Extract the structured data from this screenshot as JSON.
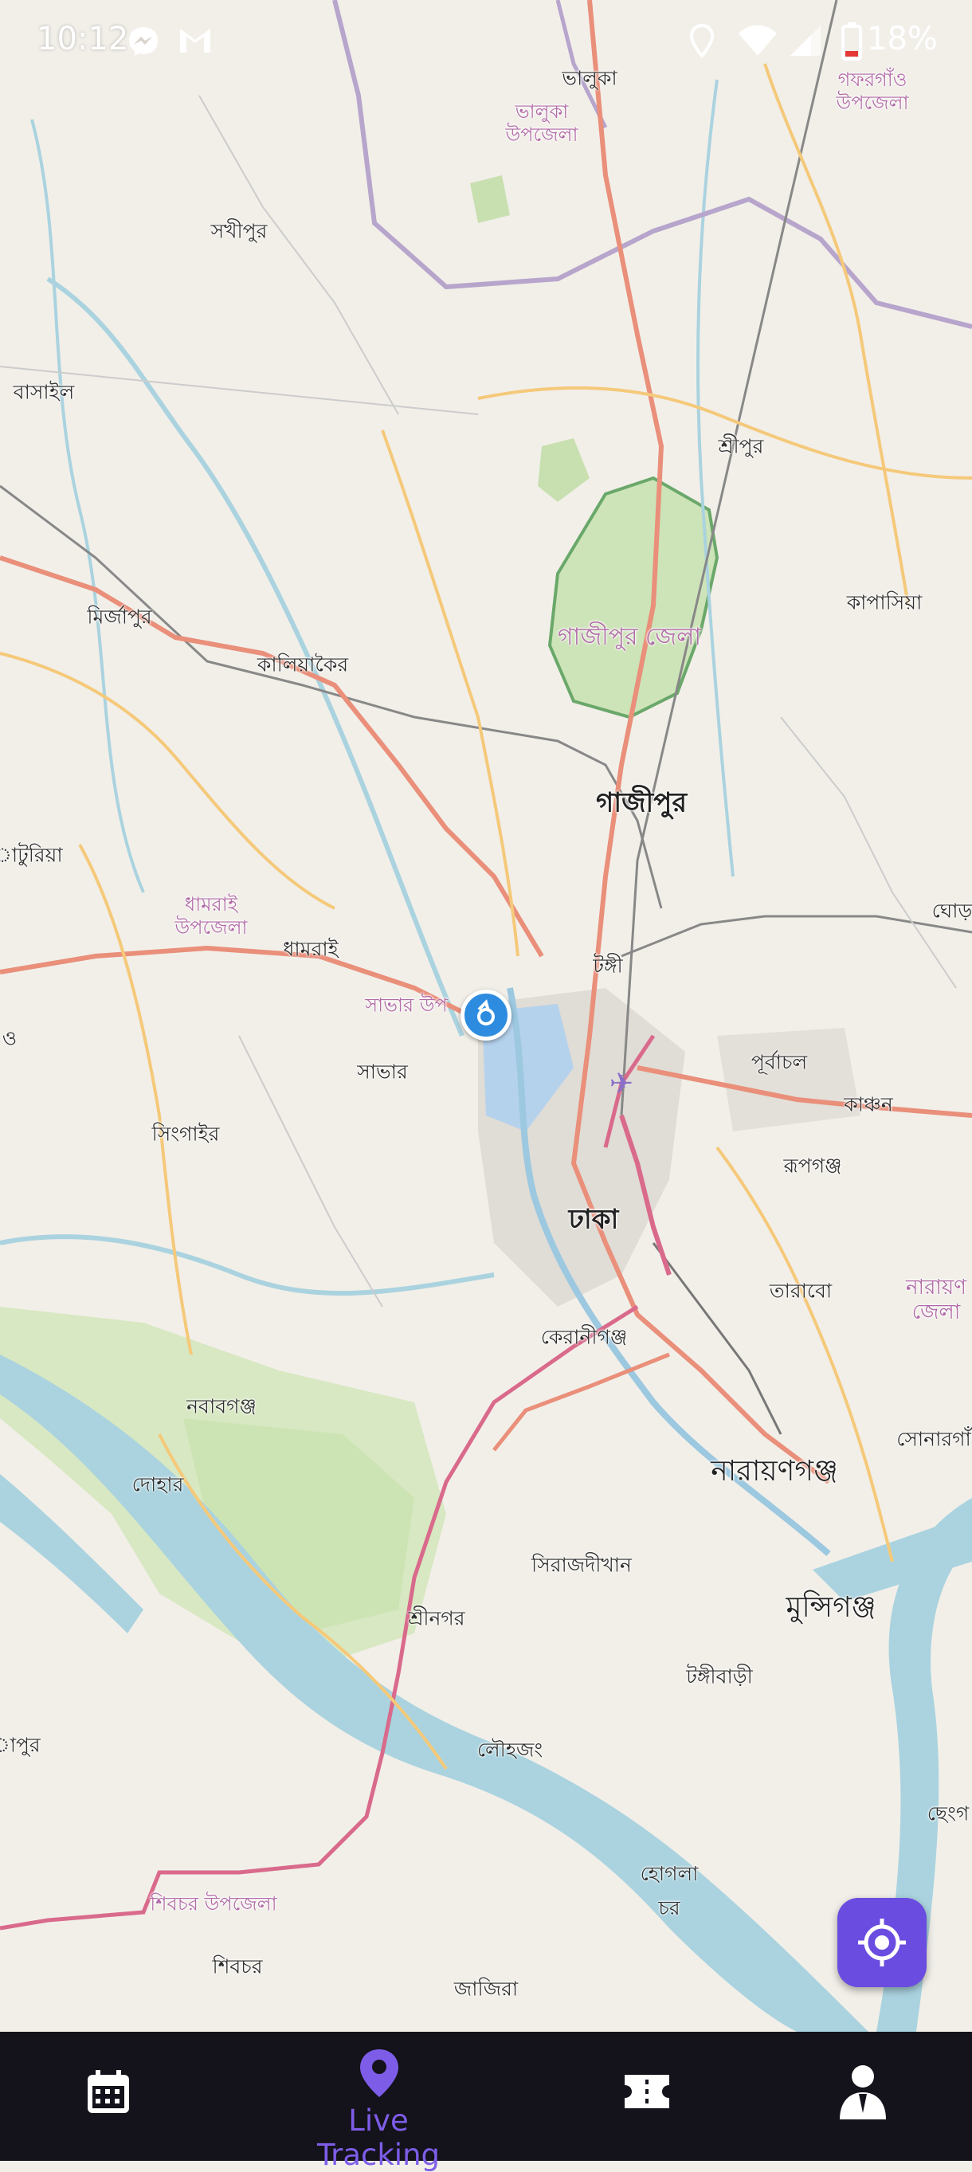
{
  "status_bar": {
    "time": "10:12",
    "battery": "18%",
    "icons": [
      "messenger-icon",
      "gmail-icon",
      "location-icon",
      "wifi-icon",
      "signal-icon",
      "battery-icon"
    ]
  },
  "map": {
    "places": {
      "bhaluka": "ভালুকা",
      "bhaluka_upazila": "ভালুকা উপজেলা",
      "gafargaon_upazila": "গফরগাঁও উপজেলা",
      "sakhipur": "সখীপুর",
      "basail": "বাসাইল",
      "sreepur": "শ্রীপুর",
      "mirzapur": "মির্জাপুর",
      "gazipur_zila": "গাজীপুর জেলা",
      "kapasia": "কাপাসিয়া",
      "kaliakair": "কালিয়াকৈর",
      "gazipur": "গাজীপুর",
      "saturia": "াটুরিয়া",
      "dhamrai_upazila": "ধামরাই উপজেলা",
      "dhamrai": "ধামরাই",
      "ghora": "ঘোড়",
      "tongi": "টঙ্গী",
      "savar_upazila": "সাভার উপ",
      "savar": "সাভার",
      "purbachal": "পূর্বাচল",
      "kanchan": "কাঞ্চন",
      "singair": "সিংগাইর",
      "rupganj": "রূপগঞ্জ",
      "dhaka": "ঢাকা",
      "tarabo": "তারাবো",
      "narayan_jela": "নারায়ণ জেলা",
      "keraniganj": "কেরানীগঞ্জ",
      "nawabganj": "নবাবগঞ্জ",
      "sonargaon": "সোনারগাঁ",
      "dohar": "দোহার",
      "narayanganj": "নারায়ণগঞ্জ",
      "sirajdikhan": "সিরাজদীখান",
      "munshiganj": "মুন্সিগঞ্জ",
      "sreenagar": "শ্রীনগর",
      "tongibari": "টঙ্গীবাড়ী",
      "lohajang": "লৌহজং",
      "chhenga": "ছেংগ",
      "apur": "াপুর",
      "hogla_char": "হোগলা চর",
      "shibchar_upazila": "শিবচর উপজেলা",
      "shibchar": "শিবচর",
      "jajira": "জাজিরা",
      "o": "ও"
    },
    "marker": "user-location-marker"
  },
  "fab": {
    "icon": "my-location-icon"
  },
  "bottom_nav": {
    "items": [
      {
        "id": "schedule",
        "icon": "calendar-icon",
        "label": ""
      },
      {
        "id": "live-tracking",
        "icon": "location-pin-icon",
        "label": "Live Tracking",
        "active": true
      },
      {
        "id": "tickets",
        "icon": "ticket-icon",
        "label": ""
      },
      {
        "id": "profile",
        "icon": "person-icon",
        "label": ""
      }
    ],
    "active_color": "#7d5de8",
    "background": "#14121a"
  }
}
